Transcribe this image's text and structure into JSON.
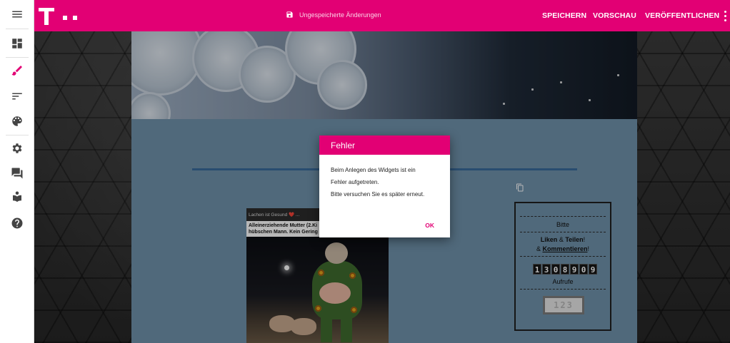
{
  "colors": {
    "brand": "#e20074",
    "page_bg": "#6f92ab",
    "line": "#3a6b9c"
  },
  "topbar": {
    "logo_icon": "telekom-t-logo",
    "unsaved_icon": "save-icon",
    "unsaved_text": "Ungespeicherte Änderungen",
    "save_label": "SPEICHERN",
    "preview_label": "VORSCHAU",
    "publish_label": "VERÖFFENTLICHEN",
    "more_icon": "more-vert-icon"
  },
  "sidebar": {
    "items": [
      {
        "icon": "menu-icon"
      },
      {
        "icon": "dashboard-icon"
      },
      {
        "icon": "brush-icon",
        "active": true
      },
      {
        "icon": "sort-icon"
      },
      {
        "icon": "palette-icon"
      },
      {
        "icon": "gear-icon"
      },
      {
        "icon": "forum-icon"
      },
      {
        "icon": "book-icon"
      },
      {
        "icon": "help-icon"
      }
    ]
  },
  "post": {
    "header": "Lachen ist Gesund ❤️ ...",
    "caption_line1": "Alleinerziehende Mutter (2.Ki",
    "caption_line2": "hübschen Mann. Kein Gering"
  },
  "widget": {
    "line1": "Bitte",
    "liken": "Liken",
    "amp": " & ",
    "teilen": "Teilen",
    "excl": "!",
    "amp2": "& ",
    "kommentieren": "Kommentieren",
    "excl2": "!",
    "counter_digits": [
      "1",
      "3",
      "0",
      "8",
      "9",
      "0",
      "9"
    ],
    "views_label": "Aufrufe",
    "captcha": "123"
  },
  "dialog": {
    "title": "Fehler",
    "line1": "Beim Anlegen des Widgets ist ein",
    "line2": "Fehler aufgetreten.",
    "line3": "Bitte versuchen Sie es später erneut.",
    "ok_label": "OK"
  }
}
